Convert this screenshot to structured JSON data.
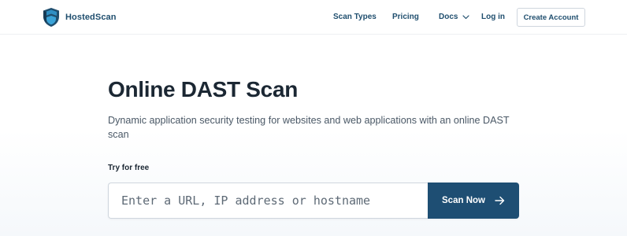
{
  "header": {
    "brand": "HostedScan",
    "nav": {
      "scan_types": "Scan Types",
      "pricing": "Pricing",
      "docs": "Docs",
      "login": "Log in",
      "create_account": "Create Account"
    }
  },
  "hero": {
    "title": "Online DAST Scan",
    "subtitle": "Dynamic application security testing for websites and web applications with an online DAST scan",
    "try_label": "Try for free",
    "input_placeholder": "Enter a URL, IP address or hostname",
    "input_value": "",
    "scan_button": "Scan Now"
  },
  "colors": {
    "brand_dark": "#1f4e6e",
    "brand_teal": "#2f8fc4",
    "button_bg": "#1e4e73"
  },
  "icons": {
    "logo": "shield-logo-icon",
    "docs_caret": "chevron-down-icon",
    "scan_arrow": "arrow-right-icon"
  }
}
